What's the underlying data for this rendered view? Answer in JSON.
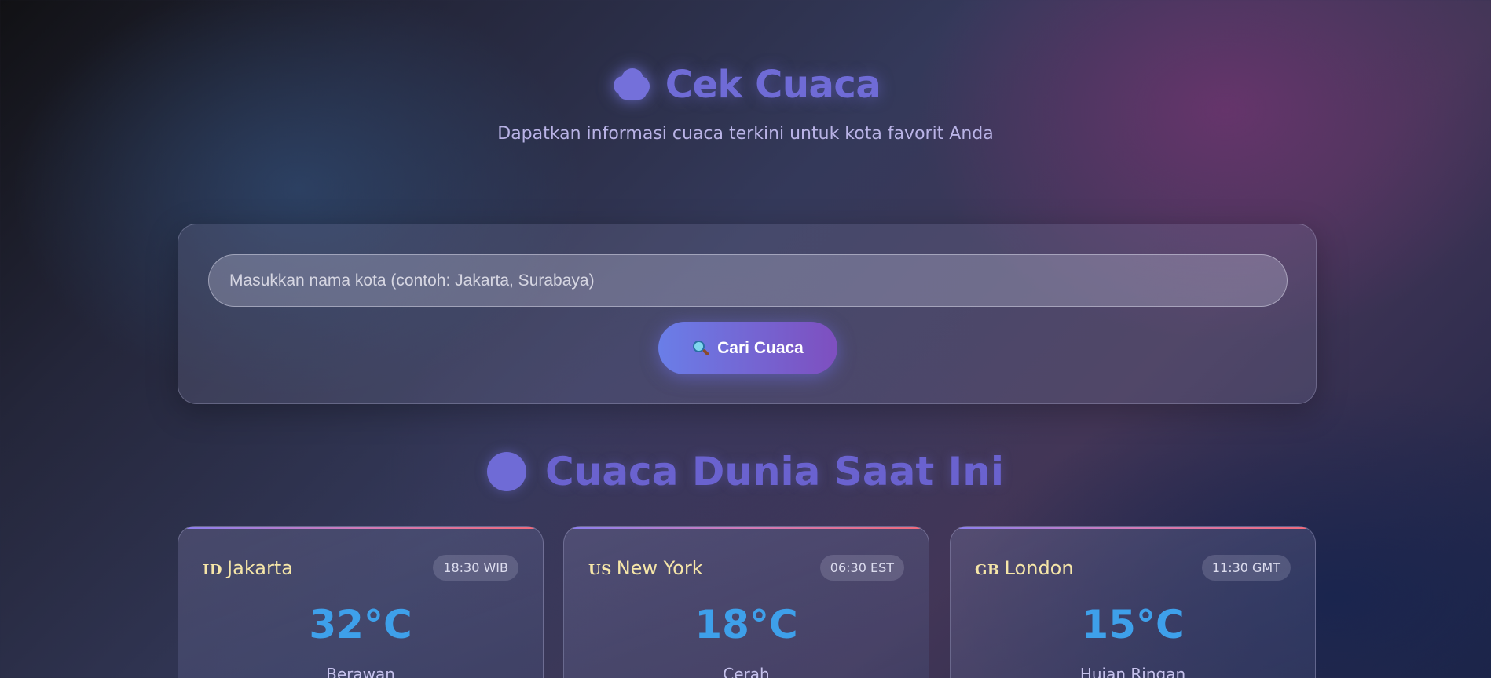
{
  "header": {
    "icon": "cloud-icon",
    "title": "Cek Cuaca",
    "subtitle": "Dapatkan informasi cuaca terkini untuk kota favorit Anda"
  },
  "search": {
    "placeholder": "Masukkan nama kota (contoh: Jakarta, Surabaya)",
    "value": "",
    "button_icon": "magnifying-glass-icon",
    "button_label": "Cari Cuaca"
  },
  "section": {
    "icon": "globe-icon",
    "title": "Cuaca Dunia Saat Ini"
  },
  "cards": [
    {
      "flag": "ID",
      "city": "Jakarta",
      "time": "18:30 WIB",
      "temp": "32°C",
      "condition": "Berawan"
    },
    {
      "flag": "US",
      "city": "New York",
      "time": "06:30 EST",
      "temp": "18°C",
      "condition": "Cerah"
    },
    {
      "flag": "GB",
      "city": "London",
      "time": "11:30 GMT",
      "temp": "15°C",
      "condition": "Hujan Ringan"
    }
  ],
  "colors": {
    "title": "#6f6bd6",
    "temperature": "#3ea0ea",
    "city_name": "#f6e6a8",
    "button_gradient_start": "#6a7ee8",
    "button_gradient_end": "#7e4fbf"
  }
}
